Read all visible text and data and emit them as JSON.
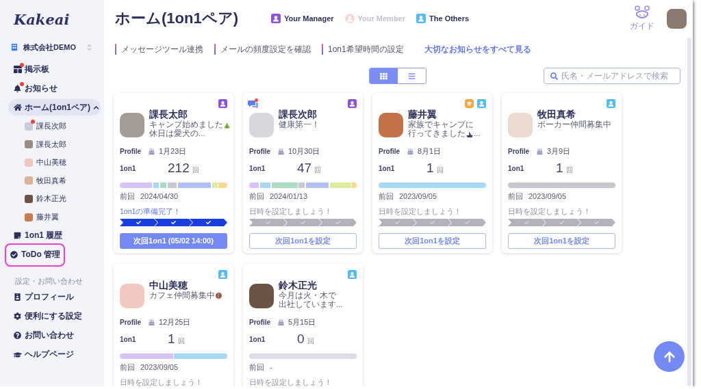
{
  "sidebar": {
    "logo": "Kakeai",
    "company": "株式会社DEMO",
    "nav": [
      {
        "label": "掲示板",
        "selected": false,
        "unread": true,
        "highlighted": false
      },
      {
        "label": "お知らせ",
        "selected": false,
        "unread": true,
        "highlighted": false
      },
      {
        "label": "ホーム(1on1ペア)",
        "selected": true,
        "unread": false,
        "highlighted": false,
        "expanded": true,
        "children": [
          {
            "label": "課長次郎",
            "selected": false,
            "unread": true
          },
          {
            "label": "課長太郎",
            "selected": false,
            "unread": false
          },
          {
            "label": "中山美穂",
            "selected": false,
            "unread": false
          },
          {
            "label": "牧田真希",
            "selected": false,
            "unread": false
          },
          {
            "label": "鈴木正光",
            "selected": false,
            "unread": false
          },
          {
            "label": "藤井翼",
            "selected": false,
            "unread": false
          }
        ]
      },
      {
        "label": "1on1 履歴",
        "selected": false,
        "unread": false,
        "highlighted": false
      },
      {
        "label": "ToDo 管理",
        "selected": false,
        "unread": false,
        "highlighted": true
      }
    ],
    "settings_heading": "設定・お問い合わせ",
    "settings": [
      {
        "label": "プロフィール",
        "selected": false
      },
      {
        "label": "便利にする設定",
        "selected": false
      },
      {
        "label": "お問い合わせ",
        "selected": false
      },
      {
        "label": "ヘルプページ",
        "selected": false
      }
    ]
  },
  "header": {
    "title": "ホーム(1on1ペア)",
    "legend": [
      {
        "kind": "manager",
        "label": "Your Manager",
        "dimmed": false
      },
      {
        "kind": "member",
        "label": "Your Member",
        "dimmed": true
      },
      {
        "kind": "others",
        "label": "The Others",
        "dimmed": false
      }
    ],
    "guide": "ガイド"
  },
  "links": [
    "メッセージツール連携",
    "メールの頻度設定を確認",
    "1on1希望時間の設定"
  ],
  "notice_link": "大切なお知らせをすべて見る",
  "view_toggle": [
    {
      "kind": "grid",
      "selected": true
    },
    {
      "kind": "list",
      "selected": false
    }
  ],
  "search": {
    "placeholder": "氏名・メールアドレスで検索"
  },
  "cards": [
    {
      "name": "課長太郎",
      "chat": false,
      "badges": [
        {
          "kind": "manager"
        }
      ],
      "status": [
        {
          "text": "キャンプ始めました",
          "emoji": true
        },
        {
          "text": "休日は愛犬の...",
          "emoji": false
        }
      ],
      "profile_label": "Profile",
      "birthday": "1月23日",
      "count_label": "1on1",
      "count": "212",
      "count_unit": "回",
      "last_label": "前回",
      "last_date": "2024/04/30",
      "message": "1on1の準備完了！",
      "prepared": true,
      "steps": [
        {
          "done": true
        },
        {
          "done": true
        },
        {
          "done": true
        }
      ],
      "button": "次回1on1 (05/02 14:00)"
    },
    {
      "name": "課長次郎",
      "chat": true,
      "badges": [
        {
          "kind": "manager"
        }
      ],
      "status": [
        {
          "text": "健康第一！",
          "emoji": false
        }
      ],
      "profile_label": "Profile",
      "birthday": "10月30日",
      "count_label": "1on1",
      "count": "47",
      "count_unit": "回",
      "last_label": "前回",
      "last_date": "2024/01/13",
      "message": "日時を設定しましょう！",
      "prepared": false,
      "steps": [
        {
          "done": false
        },
        {
          "done": false
        },
        {
          "done": false
        }
      ],
      "button": "次回1on1を設定"
    },
    {
      "name": "藤井翼",
      "chat": false,
      "badges": [
        {
          "kind": "cap"
        },
        {
          "kind": "others"
        }
      ],
      "status": [
        {
          "text": "家族でキャンプに",
          "emoji": false
        },
        {
          "text": "行ってきました",
          "emoji": true,
          "after": "..."
        }
      ],
      "profile_label": "Profile",
      "birthday": "8月1日",
      "count_label": "1on1",
      "count": "1",
      "count_unit": "回",
      "last_label": "前回",
      "last_date": "2023/09/05",
      "message": "日時を設定しましょう！",
      "prepared": false,
      "steps": [
        {
          "done": false
        },
        {
          "done": false
        },
        {
          "done": false
        }
      ],
      "button": "次回1on1を設定"
    },
    {
      "name": "牧田真希",
      "chat": false,
      "badges": [
        {
          "kind": "others"
        }
      ],
      "status": [
        {
          "text": "ポーカー仲間募集中",
          "emoji": false
        }
      ],
      "profile_label": "Profile",
      "birthday": "3月9日",
      "count_label": "1on1",
      "count": "1",
      "count_unit": "回",
      "last_label": "前回",
      "last_date": "2023/09/05",
      "message": "日時を設定しましょう！",
      "prepared": false,
      "steps": [
        {
          "done": false
        },
        {
          "done": false
        },
        {
          "done": false
        }
      ],
      "button": "次回1on1を設定"
    },
    {
      "name": "中山美穂",
      "chat": false,
      "badges": [
        {
          "kind": "others"
        }
      ],
      "status": [
        {
          "text": "カフェ仲間募集中",
          "emoji": true
        }
      ],
      "profile_label": "Profile",
      "birthday": "12月25日",
      "count_label": "1on1",
      "count": "1",
      "count_unit": "回",
      "last_label": "前回",
      "last_date": "2023/09/05",
      "message": "日時を設定しましょう！",
      "prepared": false
    },
    {
      "name": "鈴木正光",
      "chat": false,
      "badges": [
        {
          "kind": "others"
        }
      ],
      "status": [
        {
          "text": "今月は火・木で",
          "emoji": false
        },
        {
          "text": "出社しています...",
          "emoji": false
        }
      ],
      "profile_label": "Profile",
      "birthday": "5月15日",
      "count_label": "1on1",
      "count": "0",
      "count_unit": "回",
      "last_label": "前回",
      "last_date": "-",
      "message": "日時を設定しましょう！",
      "prepared": false
    }
  ]
}
